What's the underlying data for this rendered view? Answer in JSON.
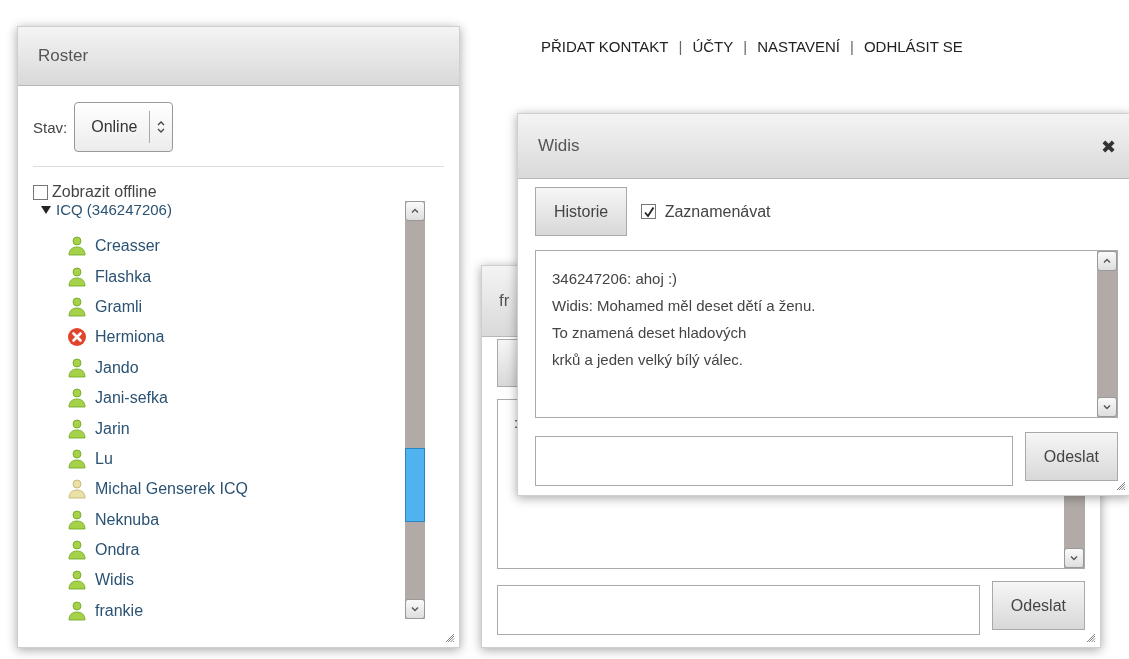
{
  "nav": [
    {
      "kind": "link",
      "label": "PŘIDAT KONTAKT"
    },
    {
      "kind": "separator",
      "label": "|"
    },
    {
      "kind": "link",
      "label": "ÚČTY"
    },
    {
      "kind": "separator",
      "label": "|"
    },
    {
      "kind": "link",
      "label": "NASTAVENÍ"
    },
    {
      "kind": "separator",
      "label": "|"
    },
    {
      "kind": "link",
      "label": "ODHLÁSIT SE"
    }
  ],
  "roster": {
    "title": "Roster",
    "status_label": "Stav:",
    "status_value": "Online",
    "show_offline": {
      "label": "Zobrazit offline",
      "checked": false
    },
    "groups": [
      {
        "label": "ICQ (346247206)",
        "expanded": true,
        "children": [
          {
            "name": "Creasser",
            "kind": "online"
          },
          {
            "name": "Flashka",
            "kind": "online"
          },
          {
            "name": "Gramli",
            "kind": "online"
          },
          {
            "name": "Hermiona",
            "kind": "busy"
          },
          {
            "name": "Jando",
            "kind": "online"
          },
          {
            "name": "Jani-sefka",
            "kind": "online"
          },
          {
            "name": "Jarin",
            "kind": "online"
          },
          {
            "name": "Lu",
            "kind": "online"
          },
          {
            "name": "Michal Genserek ICQ",
            "kind": "away"
          },
          {
            "name": "Neknuba",
            "kind": "online"
          },
          {
            "name": "Ondra",
            "kind": "online"
          },
          {
            "name": "Widis",
            "kind": "online"
          },
          {
            "name": "frankie",
            "kind": "online"
          }
        ]
      }
    ]
  },
  "chat_back": {
    "title": "fr",
    "log_fragment": ":",
    "send_button": "Odeslat"
  },
  "chat_front": {
    "title": "Widis",
    "close": "✖",
    "history_button": "Historie",
    "record": {
      "label": "Zaznamenávat",
      "checked": true
    },
    "messages": [
      "346247206: ahoj :)",
      "Widis: Mohamed měl deset dětí a ženu.\nTo znamená deset hladových\nkrků a jeden velký bílý válec."
    ],
    "send_button": "Odeslat"
  }
}
